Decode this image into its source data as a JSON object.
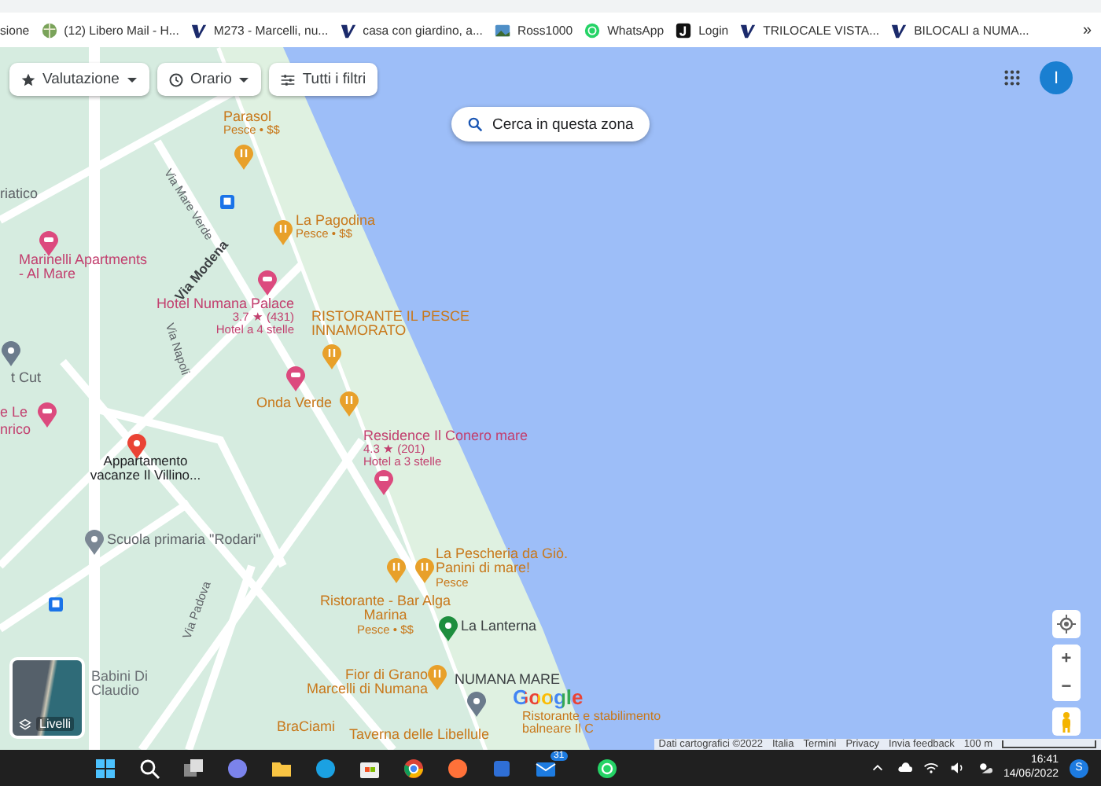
{
  "bookmarks": [
    {
      "kind": "none",
      "label": "sione"
    },
    {
      "kind": "globe",
      "label": "(12) Libero Mail - H..."
    },
    {
      "kind": "v",
      "label": "M273 - Marcelli, nu..."
    },
    {
      "kind": "v",
      "label": "casa con giardino, a..."
    },
    {
      "kind": "photo",
      "label": "Ross1000"
    },
    {
      "kind": "whatsapp",
      "label": "WhatsApp"
    },
    {
      "kind": "j",
      "label": "Login"
    },
    {
      "kind": "v",
      "label": "TRILOCALE VISTA..."
    },
    {
      "kind": "v",
      "label": "BILOCALI a NUMA..."
    }
  ],
  "bookmarks_more": "»",
  "map": {
    "filters": [
      {
        "label": "Valutazione",
        "dropdown": true
      },
      {
        "label": "Orario",
        "dropdown": true
      },
      {
        "label": "Tutti i filtri",
        "dropdown": false
      }
    ],
    "search_area_button": "Cerca in questa zona",
    "avatar": "I",
    "streets": [
      "Via Mare Verde",
      "Via Modena",
      "Via Napoli",
      "Via Padova"
    ],
    "cut_labels": [
      "riatico",
      "t Cut",
      "e Le",
      "nrico"
    ],
    "places": [
      {
        "kind": "restaurant",
        "name": "Parasol",
        "details": [
          "Pesce • $$"
        ]
      },
      {
        "kind": "restaurant",
        "name": "La Pagodina",
        "details": [
          "Pesce • $$"
        ]
      },
      {
        "kind": "hotel",
        "name": "Marinelli Apartments - Al Mare"
      },
      {
        "kind": "hotel",
        "name": "Hotel Numana Palace",
        "details": [
          "3.7 ★ (431)",
          "Hotel a 4 stelle"
        ]
      },
      {
        "kind": "restaurant",
        "name": "RISTORANTE IL PESCE INNAMORATO"
      },
      {
        "kind": "restaurant",
        "name": "Onda Verde"
      },
      {
        "kind": "hotel",
        "name": "Residence Il Conero mare",
        "details": [
          "4.3 ★ (201)",
          "Hotel a 3 stelle"
        ]
      },
      {
        "kind": "saved",
        "name": "Appartamento vacanze Il Villino..."
      },
      {
        "kind": "school",
        "name": "Scuola primaria \"Rodari\""
      },
      {
        "kind": "restaurant",
        "name": "La Pescheria da Giò. Panini di mare!",
        "details": [
          "Pesce"
        ]
      },
      {
        "kind": "restaurant",
        "name": "Ristorante - Bar Alga Marina",
        "details": [
          "Pesce • $$"
        ]
      },
      {
        "kind": "park",
        "name": "La Lanterna"
      },
      {
        "kind": "restaurant",
        "name": "Fior di Grano Marcelli di Numana"
      },
      {
        "kind": "landmark",
        "name": "NUMANA MARE"
      },
      {
        "kind": "restaurant",
        "name": "BraCiami"
      },
      {
        "kind": "restaurant",
        "name": "Taverna delle Libellule"
      },
      {
        "kind": "restaurant",
        "name": "Ristorante e stabilimento balneare Il C"
      },
      {
        "kind": "business",
        "name": "Babini Di Claudio"
      }
    ],
    "layers_button": "Livelli",
    "logo": "Google",
    "footer": [
      "Dati cartografici ©2022",
      "Italia",
      "Termini",
      "Privacy",
      "Invia feedback"
    ],
    "scale": "100 m",
    "zoom_in": "+",
    "zoom_out": "−"
  },
  "taskbar": {
    "mail_badge": "31",
    "time": "16:41",
    "date": "14/06/2022",
    "avatar": "S"
  }
}
